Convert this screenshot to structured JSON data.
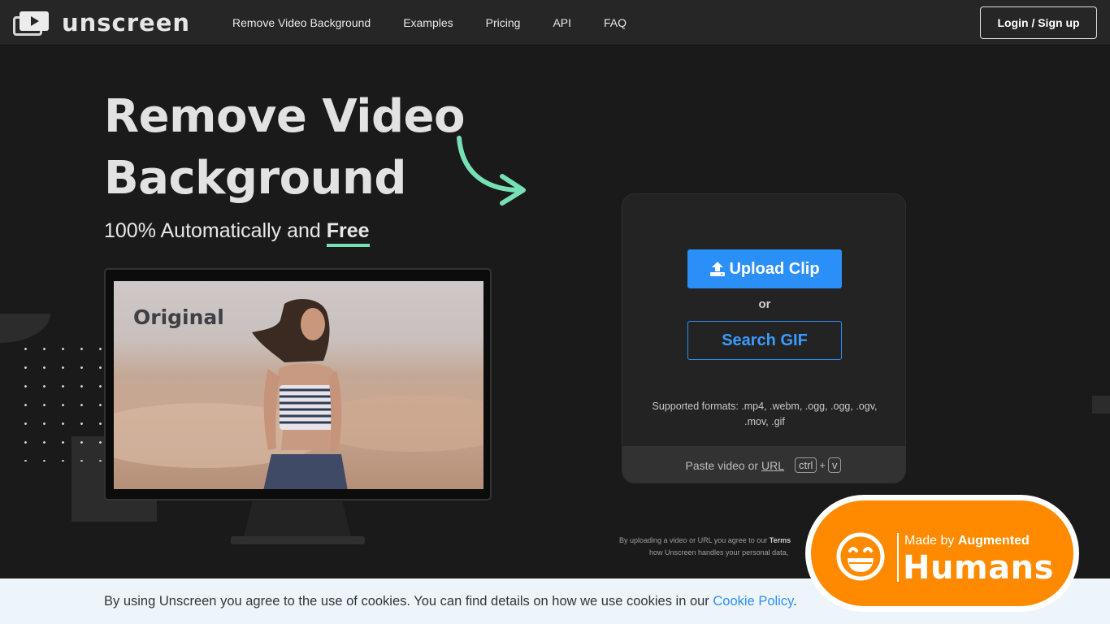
{
  "nav": {
    "brand": "unscreen",
    "links": [
      "Remove Video Background",
      "Examples",
      "Pricing",
      "API",
      "FAQ"
    ],
    "login_label": "Login / Sign up"
  },
  "hero": {
    "title_line1": "Remove Video",
    "title_line2": "Background",
    "subtitle_prefix": "100% Automatically and ",
    "subtitle_highlight": "Free",
    "preview_label": "Original"
  },
  "upload": {
    "upload_label": "Upload Clip",
    "or_label": "or",
    "gif_label": "Search GIF",
    "formats_text": "Supported formats: .mp4, .webm, .ogg, .ogg, .ogv, .mov, .gif",
    "paste_prefix": "Paste video or",
    "paste_url": "URL",
    "key_ctrl": "ctrl",
    "key_plus": "+",
    "key_v": "v"
  },
  "terms": {
    "line1_prefix": "By uploading a video or URL you agree to our ",
    "line1_bold": "Terms",
    "line2": "how Unscreen handles your personal data,"
  },
  "cookie": {
    "text": "By using Unscreen you agree to the use of cookies. You can find details on how we use cookies in our ",
    "link": "Cookie Policy",
    "suffix": "."
  },
  "badge": {
    "small_prefix": "Made by ",
    "small_bold": "Augmented",
    "big": "Humans"
  },
  "colors": {
    "accent_blue": "#2a8ff7",
    "accent_green": "#78e0b5",
    "badge_orange": "#ff8a00",
    "background": "#1a1a1b"
  }
}
